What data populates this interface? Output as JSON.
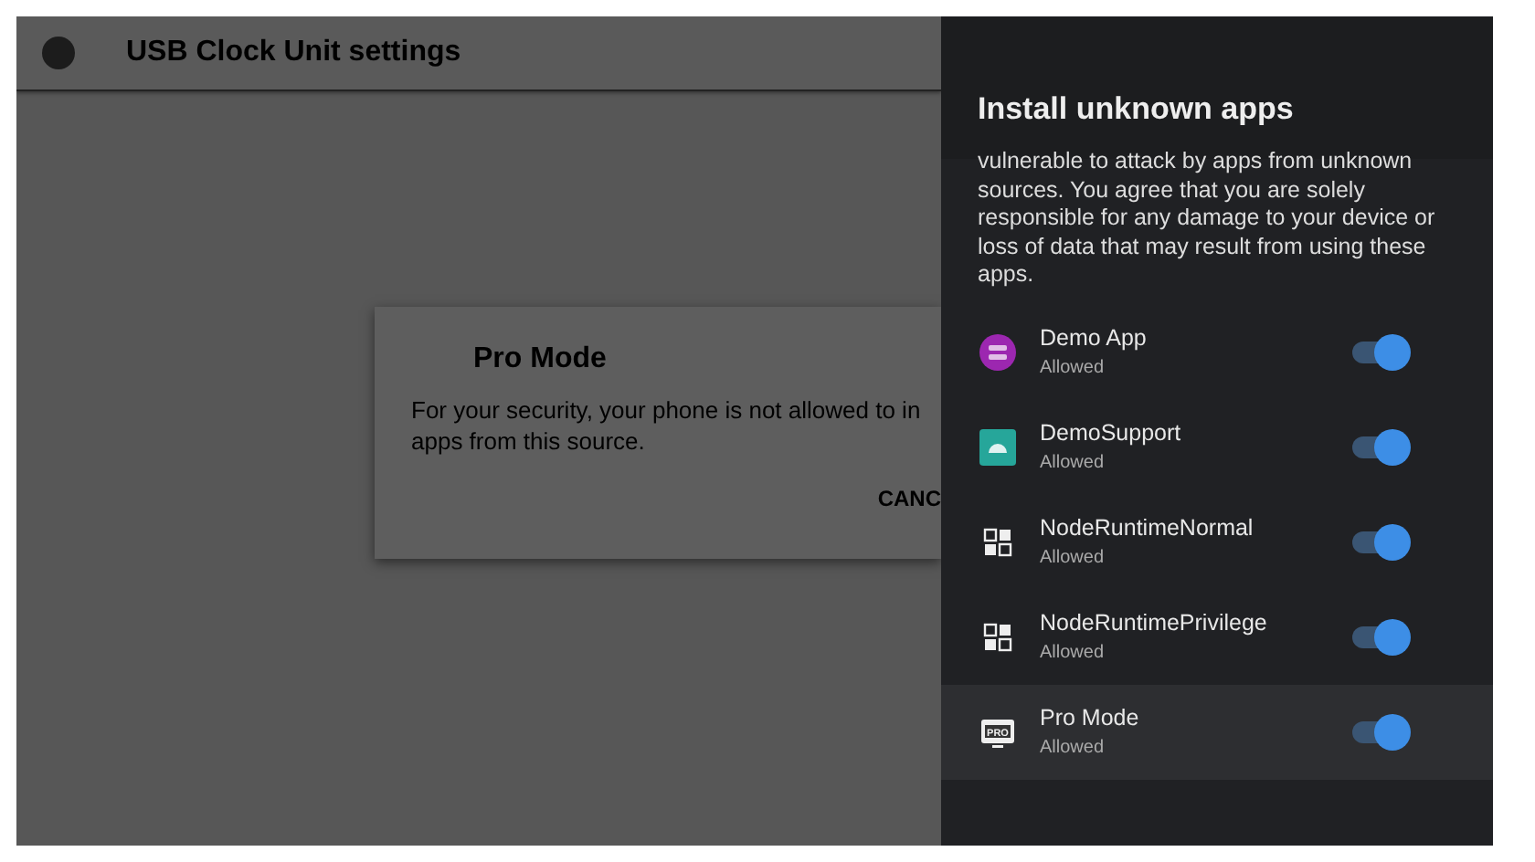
{
  "app_bar": {
    "title": "USB Clock Unit settings"
  },
  "dialog": {
    "title": "Pro Mode",
    "message_lines": [
      "For your security, your phone is not allowed to in",
      "apps from this source."
    ],
    "button": "CANC"
  },
  "panel": {
    "title": "Install unknown apps",
    "description": "vulnerable to attack by apps from unknown sources. You agree that you are solely responsible for any damage to your device or loss of data that may result from using these apps.",
    "apps": [
      {
        "name": "Demo App",
        "status": "Allowed",
        "kind": "demo",
        "on": true,
        "selected": false
      },
      {
        "name": "DemoSupport",
        "status": "Allowed",
        "kind": "android",
        "on": true,
        "selected": false
      },
      {
        "name": "NodeRuntimeNormal",
        "status": "Allowed",
        "kind": "grid",
        "on": true,
        "selected": false
      },
      {
        "name": "NodeRuntimePrivilege",
        "status": "Allowed",
        "kind": "grid",
        "on": true,
        "selected": false
      },
      {
        "name": "Pro Mode",
        "status": "Allowed",
        "kind": "pro",
        "icon_label": "PRO",
        "on": true,
        "selected": true
      }
    ]
  }
}
